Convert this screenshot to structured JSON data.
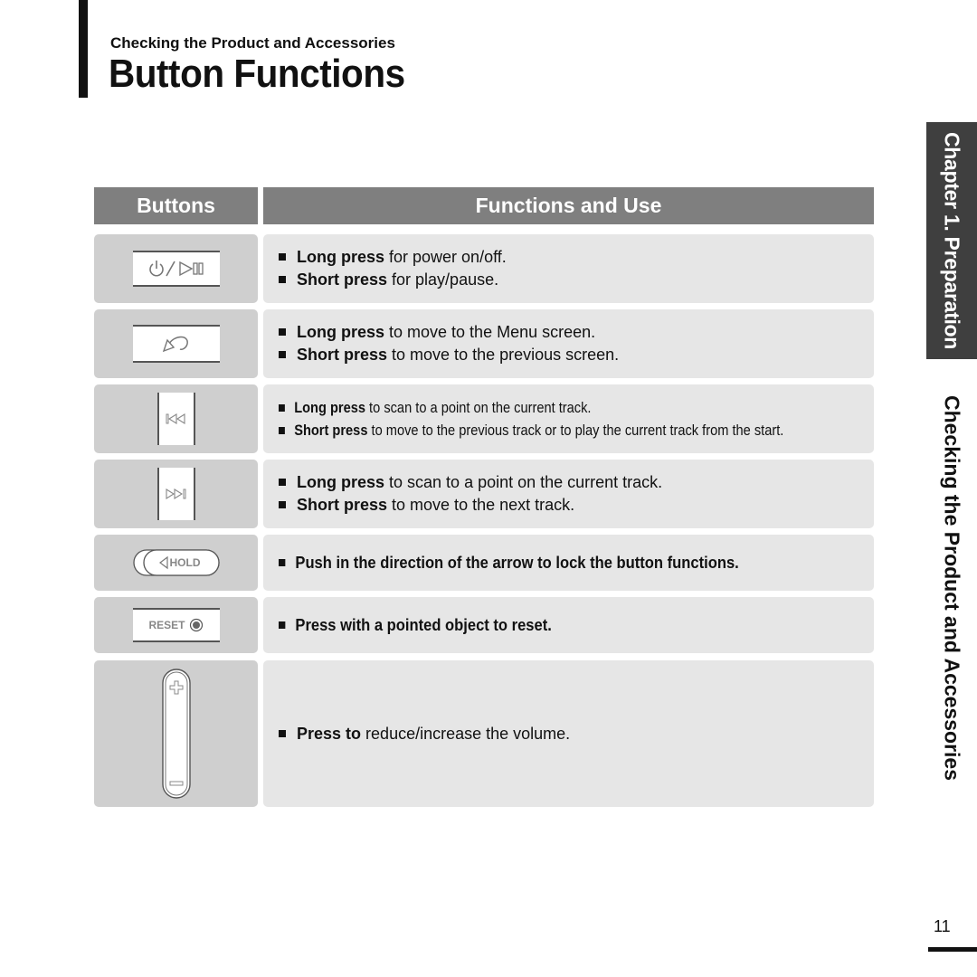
{
  "header": {
    "kicker": "Checking the Product and Accessories",
    "title": "Button Functions"
  },
  "table": {
    "col_buttons": "Buttons",
    "col_functions": "Functions and Use",
    "rows": [
      {
        "button_icon": "power-play-pause-icon",
        "lines": [
          {
            "kw": "Long press",
            "rest": " for power on/off."
          },
          {
            "kw": "Short press",
            "rest": " for play/pause."
          }
        ]
      },
      {
        "button_icon": "back-arrow-icon",
        "lines": [
          {
            "kw": "Long press",
            "rest": " to move to the Menu screen."
          },
          {
            "kw": "Short press",
            "rest": " to move to the previous screen."
          }
        ]
      },
      {
        "button_icon": "skip-previous-icon",
        "lines": [
          {
            "kw": "Long press",
            "rest": " to scan to a point on the current track."
          },
          {
            "kw": "Short press",
            "rest": " to move to the previous track or to play the current track from the start."
          }
        ]
      },
      {
        "button_icon": "skip-next-icon",
        "lines": [
          {
            "kw": "Long press",
            "rest": " to scan to a point on the current track."
          },
          {
            "kw": "Short press",
            "rest": " to move to the next track."
          }
        ]
      },
      {
        "button_icon": "hold-switch-icon",
        "button_label": "HOLD",
        "lines": [
          {
            "kw": "Push in the direction of the arrow to lock the button functions.",
            "rest": ""
          }
        ]
      },
      {
        "button_icon": "reset-button-icon",
        "button_label": "RESET",
        "lines": [
          {
            "kw": "Press with a pointed object to reset.",
            "rest": ""
          }
        ]
      },
      {
        "button_icon": "volume-rocker-icon",
        "lines": [
          {
            "kw": "Press to",
            "rest": " reduce/increase the volume."
          }
        ]
      }
    ]
  },
  "side": {
    "chapter": "Chapter 1. Preparation",
    "section": "Checking the Product and Accessories"
  },
  "page_number": "11"
}
